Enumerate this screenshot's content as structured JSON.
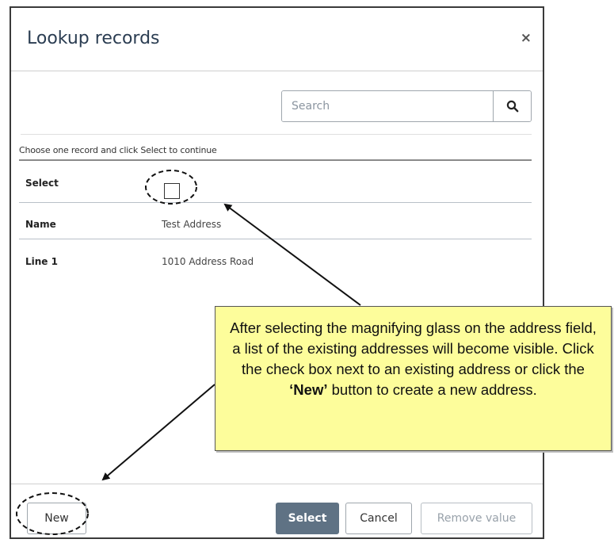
{
  "dialog": {
    "title": "Lookup records",
    "close_label": "×"
  },
  "search": {
    "placeholder": "Search",
    "icon": "search-icon"
  },
  "instruction": "Choose one record and click Select to continue",
  "rows": [
    {
      "label": "Select",
      "value": ""
    },
    {
      "label": "Name",
      "value": "Test Address"
    },
    {
      "label": "Line 1",
      "value": "1010 Address Road"
    }
  ],
  "footer": {
    "new_label": "New",
    "select_label": "Select",
    "cancel_label": "Cancel",
    "remove_label": "Remove value"
  },
  "callout": {
    "text_before": "After selecting the magnifying glass on the address field, a list of the existing addresses will become visible. Click the check box next to an existing address or click the ",
    "text_bold": "‘New’",
    "text_after": " button to create a new address."
  },
  "colors": {
    "title": "#2b3d52",
    "select_button": "#5f7284",
    "callout_bg": "#fdfd9b"
  }
}
